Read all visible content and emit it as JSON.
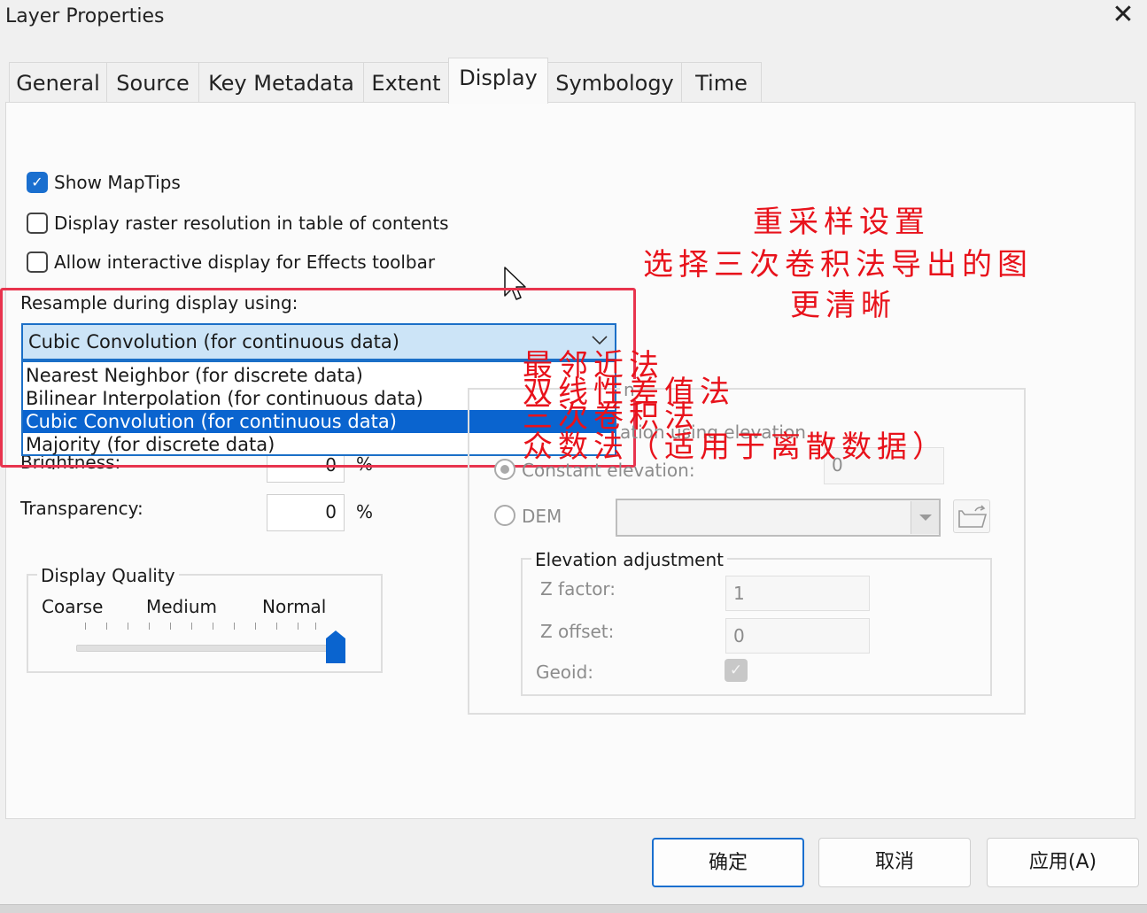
{
  "window": {
    "title": "Layer Properties",
    "close_glyph": "✕"
  },
  "tabs": [
    {
      "label": "General"
    },
    {
      "label": "Source"
    },
    {
      "label": "Key Metadata"
    },
    {
      "label": "Extent"
    },
    {
      "label": "Display",
      "active": true
    },
    {
      "label": "Symbology"
    },
    {
      "label": "Time"
    }
  ],
  "options": {
    "show_maptips": {
      "label": "Show MapTips",
      "checked": true
    },
    "display_resolution": {
      "label": "Display raster resolution in table of contents",
      "checked": false
    },
    "interactive_display": {
      "label": "Allow interactive display for Effects toolbar",
      "checked": false
    }
  },
  "resample": {
    "label": "Resample during display using:",
    "selected": "Cubic Convolution (for continuous data)",
    "list": [
      "Nearest Neighbor (for discrete data)",
      "Bilinear Interpolation (for continuous data)",
      "Cubic Convolution (for continuous data)",
      "Majority (for discrete data)"
    ],
    "highlighted_index": 2
  },
  "adjust": {
    "brightness_label": "Brightness:",
    "brightness_value": "0",
    "transparency_label": "Transparency:",
    "transparency_value": "0",
    "percent": "%"
  },
  "display_quality": {
    "title": "Display Quality",
    "labels": [
      "Coarse",
      "Medium",
      "Normal"
    ],
    "level": 1.0
  },
  "elevation": {
    "partial_title": "n",
    "use_elevation_label": "ation using elevation",
    "constant_label": "Constant elevation:",
    "constant_value": "0",
    "dem_label": "DEM",
    "adjustment_title": "Elevation adjustment",
    "z_factor_label": "Z factor:",
    "z_factor_value": "1",
    "z_offset_label": "Z offset:",
    "z_offset_value": "0",
    "geoid_label": "Geoid:"
  },
  "buttons": {
    "ok": "确定",
    "cancel": "取消",
    "apply": "应用(A)"
  },
  "annotations": {
    "title_lines": [
      "重采样设置",
      "选择三次卷积法导出的图",
      "更清晰"
    ],
    "method_labels": [
      "最邻近法",
      "双线性差值法",
      "三次卷积法",
      "众数法（适用于离散数据）"
    ]
  },
  "colors": {
    "accent": "#1a6fcf",
    "annotation": "#e8121b",
    "highlight_box": "#e8344e"
  }
}
